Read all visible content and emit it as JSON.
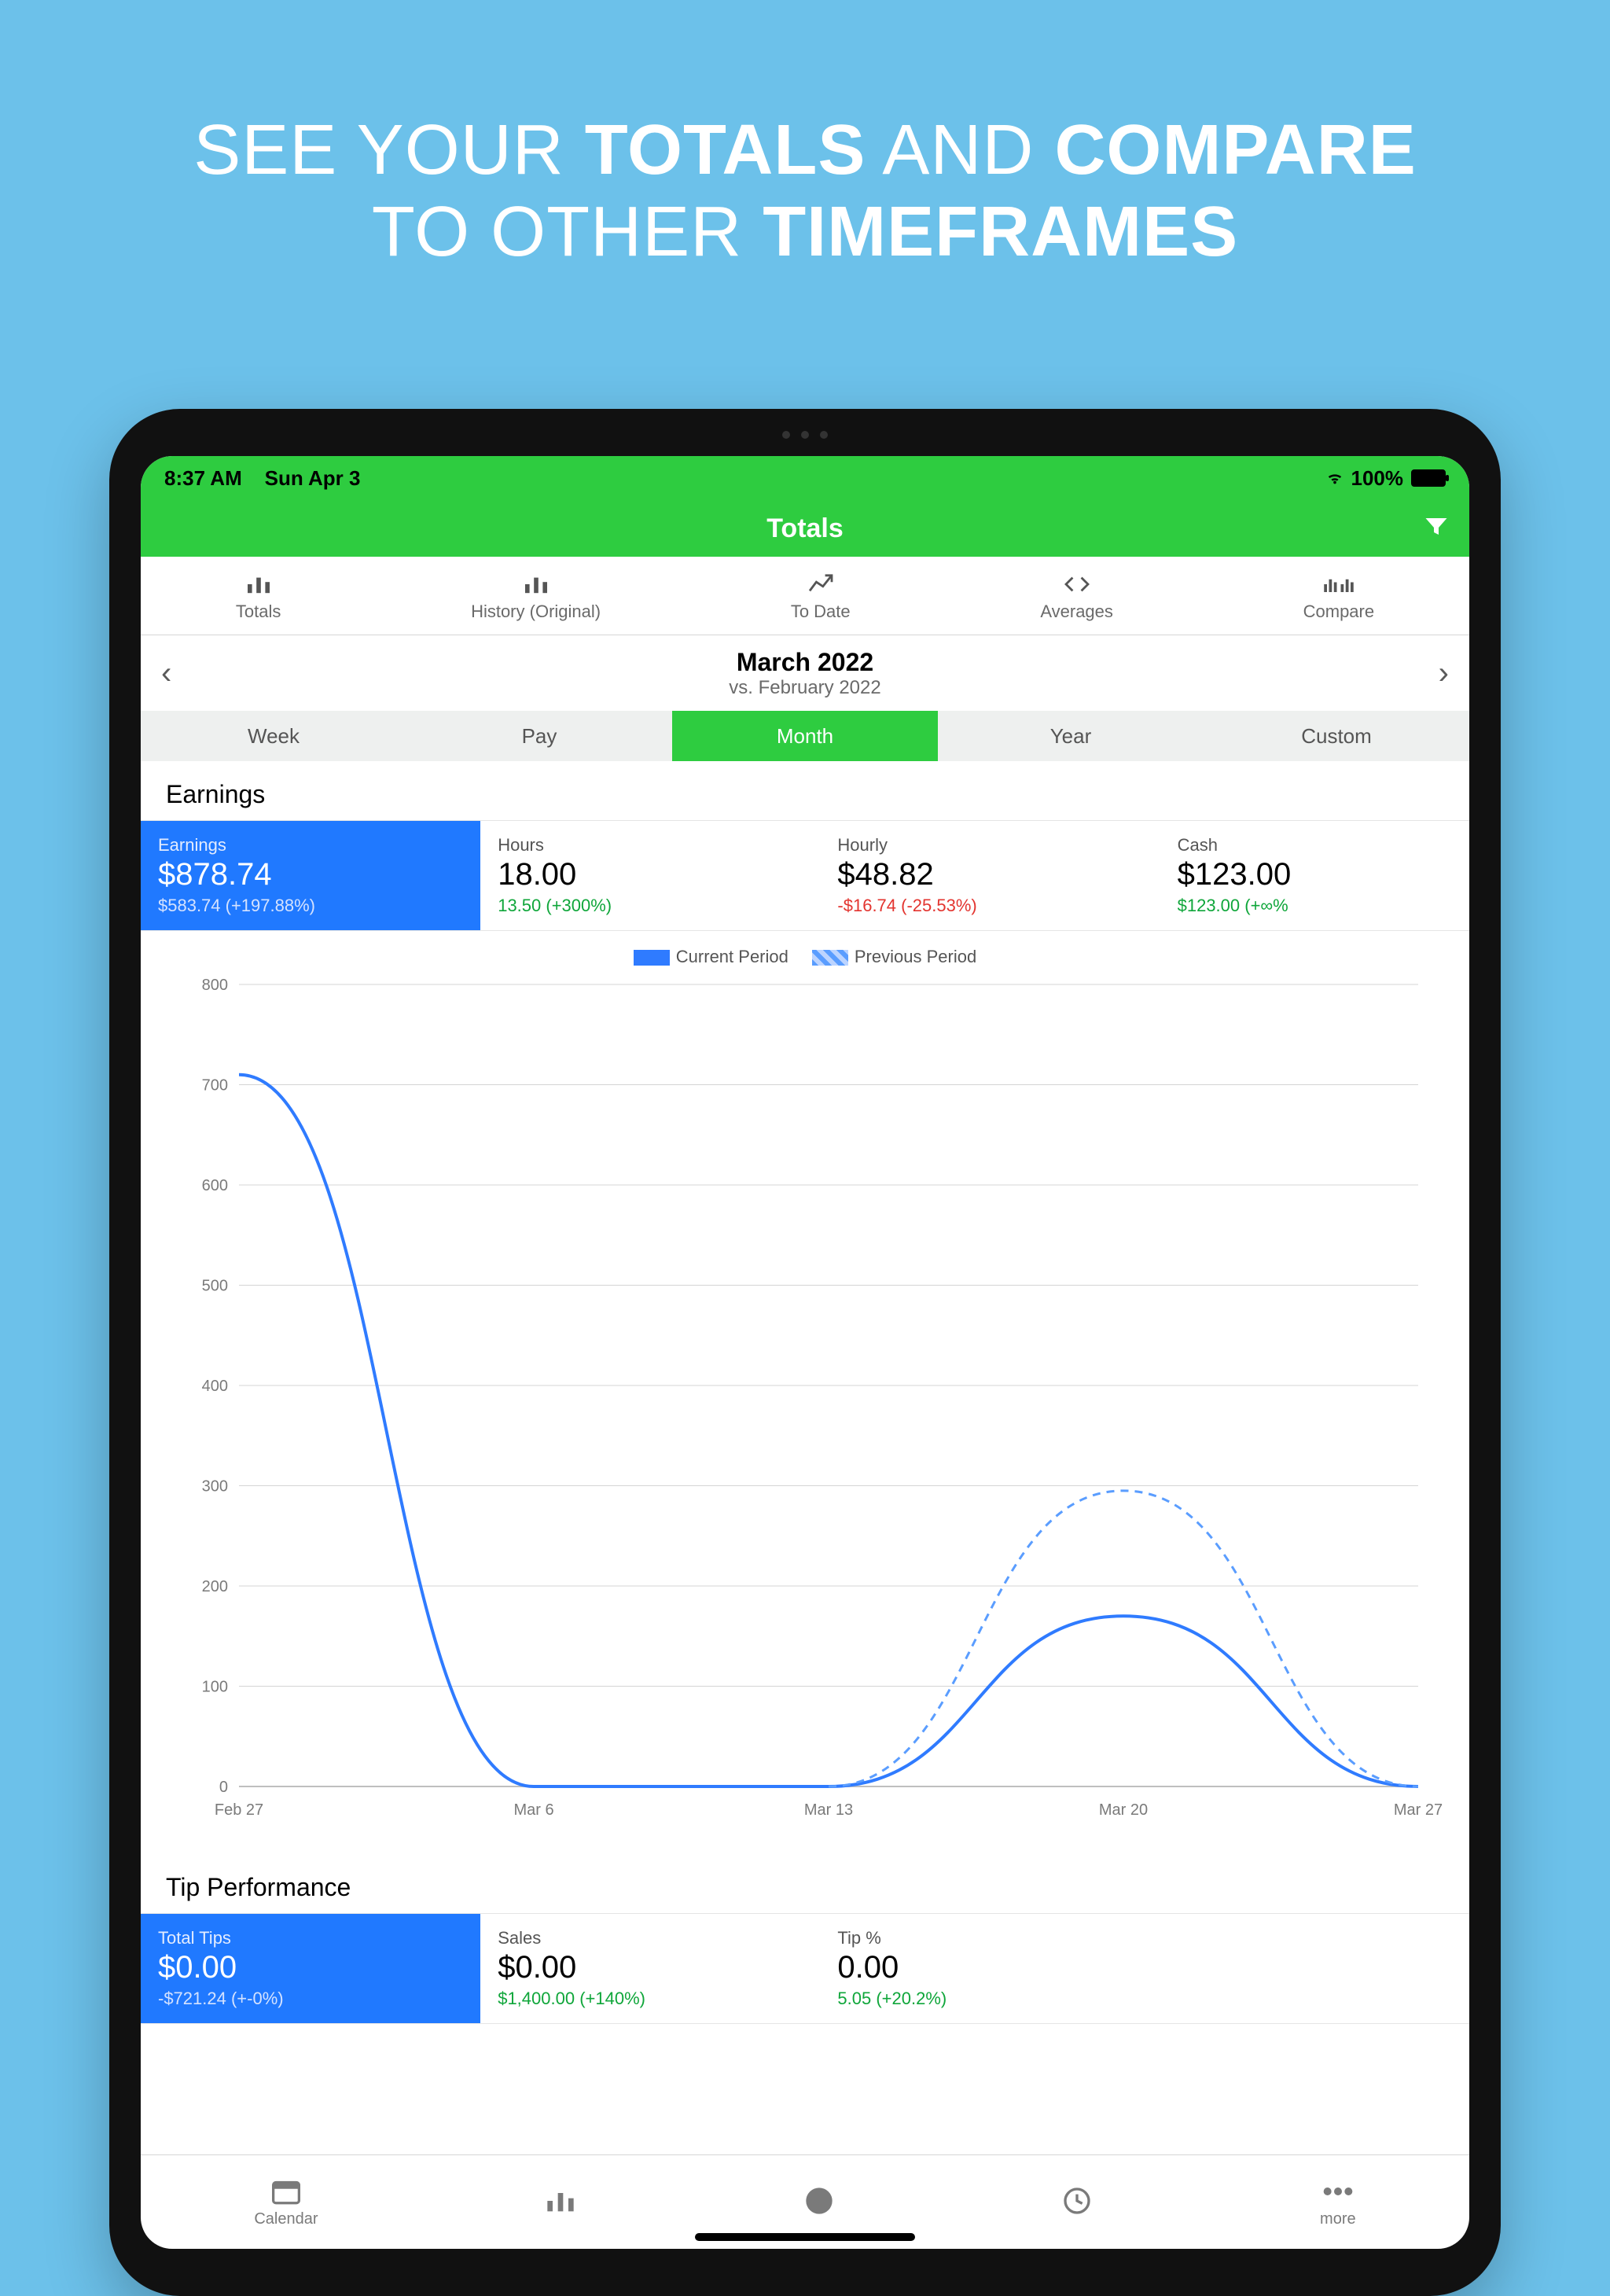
{
  "promo_headline": {
    "parts": [
      "SEE YOUR ",
      "TOTALS",
      " AND ",
      "COMPARE",
      " TO OTHER ",
      "TIMEFRAMES"
    ]
  },
  "statusbar": {
    "time": "8:37 AM",
    "date": "Sun Apr 3",
    "battery": "100%"
  },
  "navbar": {
    "title": "Totals"
  },
  "subtabs": [
    {
      "label": "Totals"
    },
    {
      "label": "History (Original)"
    },
    {
      "label": "To Date"
    },
    {
      "label": "Averages"
    },
    {
      "label": "Compare"
    }
  ],
  "period": {
    "title": "March 2022",
    "subtitle": "vs. February 2022"
  },
  "segments": [
    "Week",
    "Pay",
    "Month",
    "Year",
    "Custom"
  ],
  "active_segment": "Month",
  "earnings": {
    "section_title": "Earnings",
    "cards": [
      {
        "label": "Earnings",
        "value": "$878.74",
        "delta": "$583.74 (+197.88%)",
        "active": true
      },
      {
        "label": "Hours",
        "value": "18.00",
        "delta": "13.50 (+300%)",
        "delta_class": "green"
      },
      {
        "label": "Hourly",
        "value": "$48.82",
        "delta": "-$16.74 (-25.53%)",
        "delta_class": "red"
      },
      {
        "label": "Cash",
        "value": "$123.00",
        "delta": "$123.00 (+∞%",
        "delta_class": "green"
      }
    ]
  },
  "chart_legend": {
    "current": "Current Period",
    "previous": "Previous Period"
  },
  "chart_data": {
    "type": "line",
    "title": "Earnings — Current vs Previous Period",
    "xlabel": "",
    "ylabel": "",
    "ylim": [
      0,
      800
    ],
    "yticks": [
      0,
      100,
      200,
      300,
      400,
      500,
      600,
      700,
      800
    ],
    "categories": [
      "Feb 27",
      "Mar 6",
      "Mar 13",
      "Mar 20",
      "Mar 27"
    ],
    "series": [
      {
        "name": "Current Period",
        "values": [
          710,
          0,
          0,
          170,
          0
        ],
        "style": "solid"
      },
      {
        "name": "Previous Period",
        "values": [
          null,
          null,
          0,
          295,
          0
        ],
        "style": "dashed"
      }
    ]
  },
  "tip_perf": {
    "section_title": "Tip Performance",
    "cards": [
      {
        "label": "Total Tips",
        "value": "$0.00",
        "delta": "-$721.24 (+-0%)",
        "active": true
      },
      {
        "label": "Sales",
        "value": "$0.00",
        "delta": "$1,400.00 (+140%)",
        "delta_class": "green"
      },
      {
        "label": "Tip %",
        "value": "0.00",
        "delta": "5.05 (+20.2%)",
        "delta_class": "green"
      }
    ]
  },
  "bottom_tabs": [
    {
      "label": "Calendar"
    },
    {
      "label": ""
    },
    {
      "label": ""
    },
    {
      "label": ""
    },
    {
      "label": "more"
    }
  ]
}
